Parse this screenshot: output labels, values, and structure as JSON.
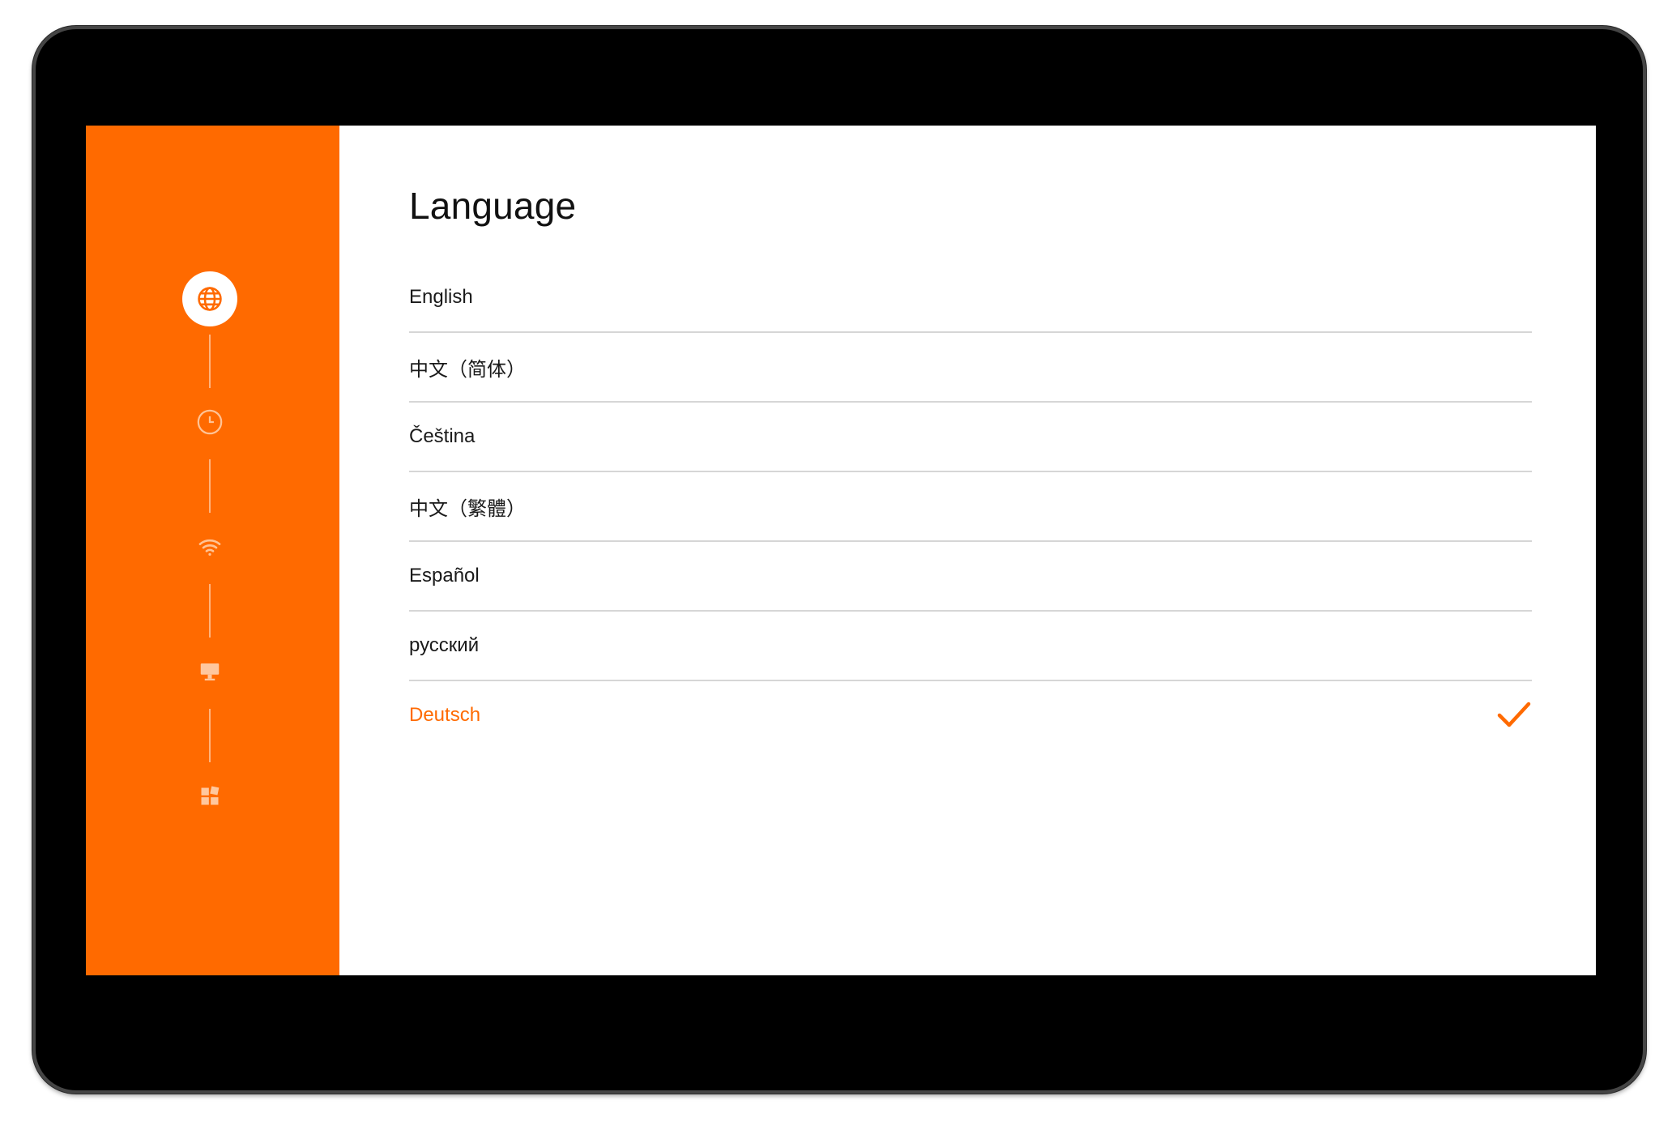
{
  "colors": {
    "accent": "#ff6a00",
    "text": "#1a1a1a",
    "divider": "#d6d6d6",
    "bezel": "#000000"
  },
  "sidebar": {
    "steps": [
      {
        "icon": "globe-icon",
        "state": "active"
      },
      {
        "icon": "clock-icon",
        "state": "pending"
      },
      {
        "icon": "wifi-icon",
        "state": "pending"
      },
      {
        "icon": "display-icon",
        "state": "pending"
      },
      {
        "icon": "apps-grid-icon",
        "state": "pending"
      }
    ]
  },
  "main": {
    "title": "Language",
    "languages": [
      {
        "label": "English",
        "selected": false
      },
      {
        "label": "中文（简体）",
        "selected": false
      },
      {
        "label": "Čeština",
        "selected": false
      },
      {
        "label": "中文（繁體）",
        "selected": false
      },
      {
        "label": "Español",
        "selected": false
      },
      {
        "label": "русский",
        "selected": false
      },
      {
        "label": "Deutsch",
        "selected": true
      }
    ],
    "selected_indicator_icon": "checkmark-icon"
  }
}
